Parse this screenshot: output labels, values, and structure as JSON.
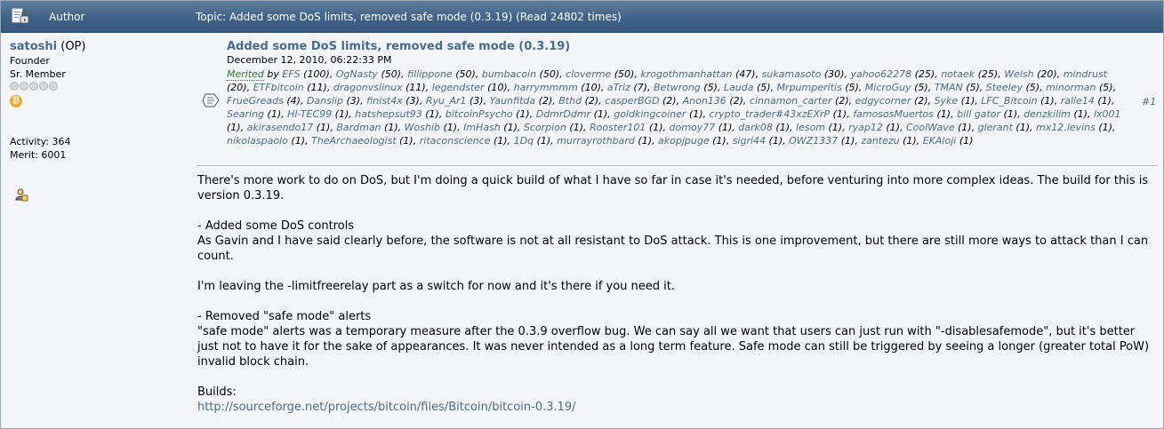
{
  "header": {
    "author_label": "Author",
    "topic_text": "Topic: Added some DoS limits, removed safe mode (0.3.19)  (Read 24802 times)"
  },
  "author": {
    "name": "satoshi",
    "op_tag": "(OP)",
    "title": "Founder",
    "rank": "Sr. Member",
    "stars_count": 5,
    "activity": "Activity: 364",
    "merit": "Merit: 6001"
  },
  "post": {
    "title": "Added some DoS limits, removed safe mode (0.3.19)",
    "date": "December 12, 2010, 06:22:33 PM",
    "number": "#1",
    "merited_label": "Merited",
    "by_label": " by ",
    "merits": [
      {
        "user": "EFS",
        "count": "(100)"
      },
      {
        "user": "OgNasty",
        "count": "(50)"
      },
      {
        "user": "fillippone",
        "count": "(50)"
      },
      {
        "user": "bumbacoin",
        "count": "(50)"
      },
      {
        "user": "cloverme",
        "count": "(50)"
      },
      {
        "user": "krogothmanhattan",
        "count": "(47)"
      },
      {
        "user": "sukamasoto",
        "count": "(30)"
      },
      {
        "user": "yahoo62278",
        "count": "(25)"
      },
      {
        "user": "notaek",
        "count": "(25)"
      },
      {
        "user": "Welsh",
        "count": "(20)"
      },
      {
        "user": "mindrust",
        "count": "(20)"
      },
      {
        "user": "ETFbitcoin",
        "count": "(11)"
      },
      {
        "user": "dragonvslinux",
        "count": "(11)"
      },
      {
        "user": "legendster",
        "count": "(10)"
      },
      {
        "user": "harrymmmm",
        "count": "(10)"
      },
      {
        "user": "aTriz",
        "count": "(7)"
      },
      {
        "user": "Betwrong",
        "count": "(5)"
      },
      {
        "user": "Lauda",
        "count": "(5)"
      },
      {
        "user": "Mrpumperitis",
        "count": "(5)"
      },
      {
        "user": "MicroGuy",
        "count": "(5)"
      },
      {
        "user": "TMAN",
        "count": "(5)"
      },
      {
        "user": "Steeley",
        "count": "(5)"
      },
      {
        "user": "minorman",
        "count": "(5)"
      },
      {
        "user": "FrueGreads",
        "count": "(4)"
      },
      {
        "user": "Danslip",
        "count": "(3)"
      },
      {
        "user": "finist4x",
        "count": "(3)"
      },
      {
        "user": "Ryu_Ar1",
        "count": "(3)"
      },
      {
        "user": "Yaunfitda",
        "count": "(2)"
      },
      {
        "user": "Bthd",
        "count": "(2)"
      },
      {
        "user": "casperBGD",
        "count": "(2)"
      },
      {
        "user": "Anon136",
        "count": "(2)"
      },
      {
        "user": "cinnamon_carter",
        "count": "(2)"
      },
      {
        "user": "edgycorner",
        "count": "(2)"
      },
      {
        "user": "Syke",
        "count": "(1)"
      },
      {
        "user": "LFC_Bitcoin",
        "count": "(1)"
      },
      {
        "user": "ralle14",
        "count": "(1)"
      },
      {
        "user": "Searing",
        "count": "(1)"
      },
      {
        "user": "HI-TEC99",
        "count": "(1)"
      },
      {
        "user": "hatshepsut93",
        "count": "(1)"
      },
      {
        "user": "bitcoinPsycho",
        "count": "(1)"
      },
      {
        "user": "DdmrDdmr",
        "count": "(1)"
      },
      {
        "user": "goldkingcoiner",
        "count": "(1)"
      },
      {
        "user": "crypto_trader#43xzEXrP",
        "count": "(1)"
      },
      {
        "user": "famososMuertos",
        "count": "(1)"
      },
      {
        "user": "bill gator",
        "count": "(1)"
      },
      {
        "user": "denzkilim",
        "count": "(1)"
      },
      {
        "user": "lx001",
        "count": "(1)"
      },
      {
        "user": "akirasendo17",
        "count": "(1)"
      },
      {
        "user": "Bardman",
        "count": "(1)"
      },
      {
        "user": "Woshib",
        "count": "(1)"
      },
      {
        "user": "ImHash",
        "count": "(1)"
      },
      {
        "user": "Scorpion",
        "count": "(1)"
      },
      {
        "user": "Rooster101",
        "count": "(1)"
      },
      {
        "user": "domoy77",
        "count": "(1)"
      },
      {
        "user": "dark08",
        "count": "(1)"
      },
      {
        "user": "lesom",
        "count": "(1)"
      },
      {
        "user": "ryap12",
        "count": "(1)"
      },
      {
        "user": "CoolWave",
        "count": "(1)"
      },
      {
        "user": "glerant",
        "count": "(1)"
      },
      {
        "user": "mx12.levins",
        "count": "(1)"
      },
      {
        "user": "nikolaspaolo",
        "count": "(1)"
      },
      {
        "user": "TheArchaeologist",
        "count": "(1)"
      },
      {
        "user": "ritaconscience",
        "count": "(1)"
      },
      {
        "user": "1Dq",
        "count": "(1)"
      },
      {
        "user": "murrayrothbard",
        "count": "(1)"
      },
      {
        "user": "akopjpuge",
        "count": "(1)"
      },
      {
        "user": "sigri44",
        "count": "(1)"
      },
      {
        "user": "OWZ1337",
        "count": "(1)"
      },
      {
        "user": "zantezu",
        "count": "(1)"
      },
      {
        "user": "EKAloji",
        "count": "(1)"
      }
    ],
    "body": {
      "p1": "There's more work to do on DoS, but I'm doing a quick build of what I have so far in case it's needed, before venturing into more complex ideas.  The build for this is version 0.3.19.",
      "p2_head": "- Added some DoS controls",
      "p2": "As Gavin and I have said clearly before, the software is not at all resistant to DoS attack.  This is one improvement, but there are still more ways to attack than I can count.",
      "p3": "I'm leaving the -limitfreerelay part as a switch for now and it's there if you need it.",
      "p4_head": "- Removed \"safe mode\" alerts",
      "p4": "\"safe mode\" alerts was a temporary measure after the 0.3.9 overflow bug.  We can say all we want that users can just run with \"-disablesafemode\", but it's better just not to have it for the sake of appearances.  It was never intended as a long term feature.  Safe mode can still be triggered by seeing a longer (greater total PoW) invalid block chain.",
      "builds_label": "Builds:",
      "builds_link": "http://sourceforge.net/projects/bitcoin/files/Bitcoin/bitcoin-0.3.19/"
    }
  },
  "colors": {
    "header_bg": "#3f6287",
    "link": "#476c8e",
    "merited": "#2f7a2f",
    "bitcoin_badge": "#f5a623"
  },
  "icons": [
    "document-icon",
    "quote-icon",
    "bitcoin-badge-icon",
    "profile-icon"
  ]
}
